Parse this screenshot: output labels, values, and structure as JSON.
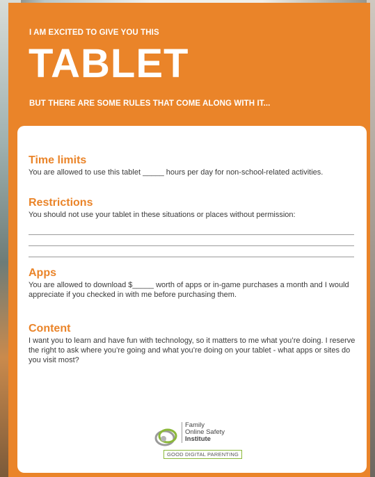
{
  "kicker": "I AM EXCITED TO GIVE YOU THIS",
  "title": "TABLET",
  "subtitle": "BUT THERE ARE SOME RULES THAT COME ALONG WITH IT...",
  "sections": [
    {
      "heading": "Time limits",
      "text": "You are allowed to use this tablet _____ hours per day for non-school-related activities."
    },
    {
      "heading": "Restrictions",
      "text": "You should not use your tablet in these situations or places without permission:"
    },
    {
      "heading": "Apps",
      "text": "You are allowed to download $_____ worth of apps or in-game purchases a month and I would appreciate if you checked in with me before purchasing them."
    },
    {
      "heading": "Content",
      "text": "I want you to learn and have fun with technology, so it matters to me what you’re doing. I reserve the right to ask where you’re going and what you’re doing on your tablet - what apps or sites do you visit most?"
    }
  ],
  "logo": {
    "line1": "Family",
    "line2": "Online Safety",
    "line3": "Institute",
    "badge": "GOOD DIGITAL PARENTING"
  },
  "colors": {
    "accent": "#ea8429",
    "logo_green": "#8bb83a"
  }
}
